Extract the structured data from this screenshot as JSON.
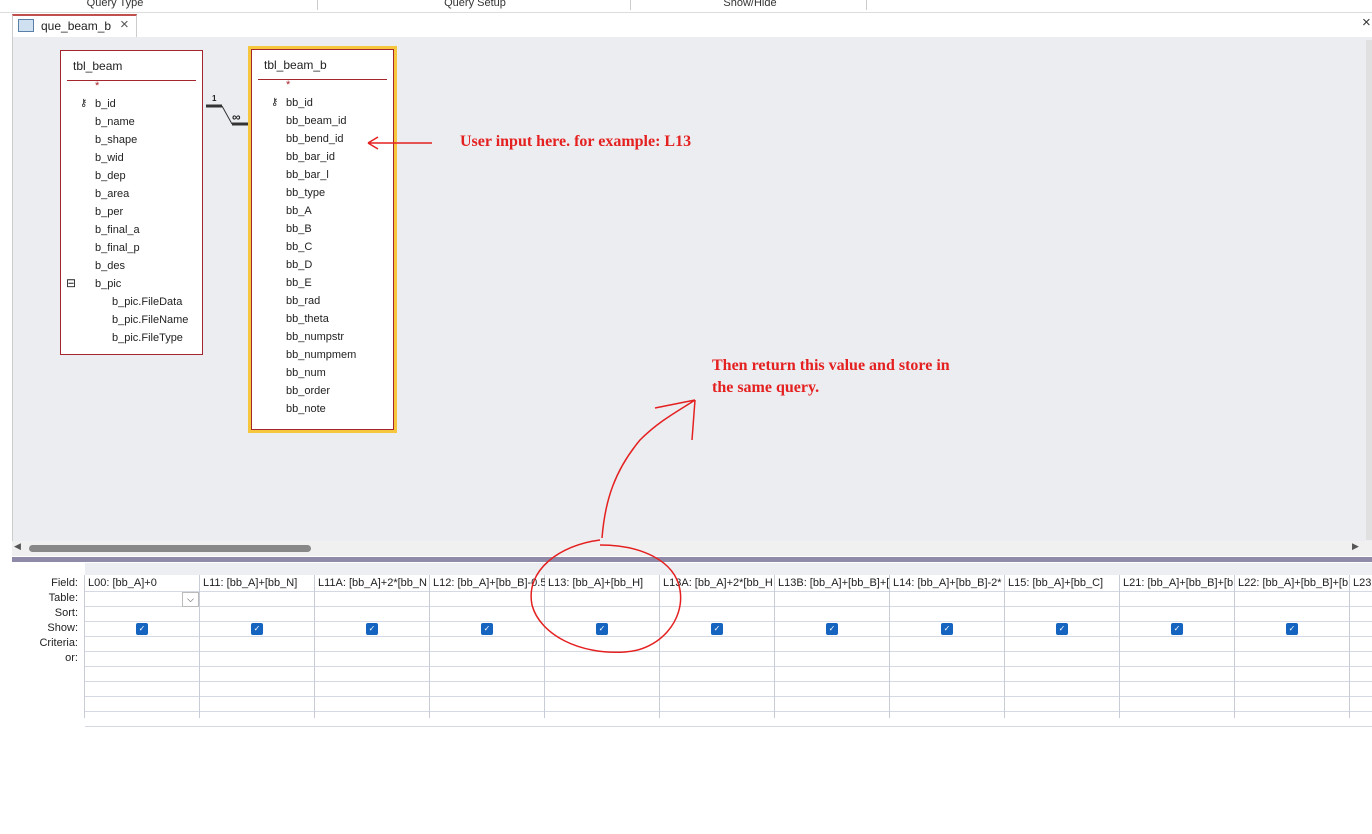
{
  "ribbon": {
    "groups": [
      "Query Type",
      "Query Setup",
      "Show/Hide"
    ]
  },
  "tab": {
    "label": "que_beam_b"
  },
  "tables": [
    {
      "name": "tbl_beam",
      "fields": [
        "*",
        "b_id",
        "b_name",
        "b_shape",
        "b_wid",
        "b_dep",
        "b_area",
        "b_per",
        "b_final_a",
        "b_final_p",
        "b_des",
        "b_pic",
        "b_pic.FileData",
        "b_pic.FileName",
        "b_pic.FileType"
      ]
    },
    {
      "name": "tbl_beam_b",
      "fields": [
        "*",
        "bb_id",
        "bb_beam_id",
        "bb_bend_id",
        "bb_bar_id",
        "bb_bar_l",
        "bb_type",
        "bb_A",
        "bb_B",
        "bb_C",
        "bb_D",
        "bb_E",
        "bb_rad",
        "bb_theta",
        "bb_numpstr",
        "bb_numpmem",
        "bb_num",
        "bb_order",
        "bb_note"
      ]
    }
  ],
  "relationship": {
    "one": "1",
    "many": "∞"
  },
  "grid": {
    "row_labels": [
      "Field:",
      "Table:",
      "Sort:",
      "Show:",
      "Criteria:",
      "or:"
    ],
    "fields": [
      "L00: [bb_A]+0",
      "L11: [bb_A]+[bb_N]",
      "L11A: [bb_A]+2*[bb_N",
      "L12: [bb_A]+[bb_B]-0.5",
      "L13: [bb_A]+[bb_H]",
      "L13A: [bb_A]+2*[bb_H",
      "L13B: [bb_A]+[bb_B]+[",
      "L14: [bb_A]+[bb_B]-2*",
      "L15: [bb_A]+[bb_C]",
      "L21: [bb_A]+[bb_B]+[b",
      "L22: [bb_A]+[bb_B]+[b",
      "L23:"
    ],
    "show": [
      true,
      true,
      true,
      true,
      true,
      true,
      true,
      true,
      true,
      true,
      true
    ]
  },
  "annotations": {
    "input_note": "User input here. for example: L13",
    "return_note_1": "Then return this value and store in",
    "return_note_2": "the same query.",
    "color": "#e52020"
  }
}
